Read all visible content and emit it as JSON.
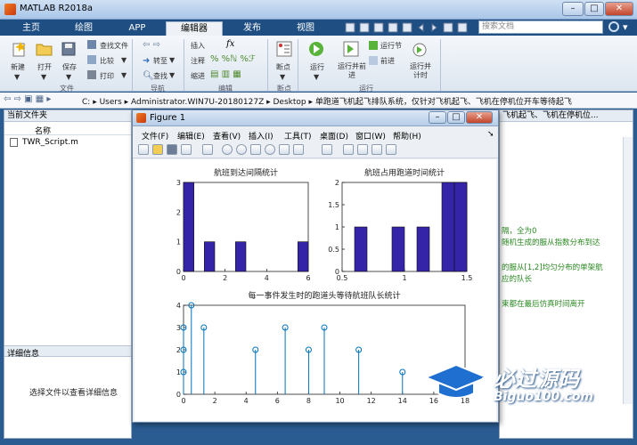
{
  "app": {
    "title": "MATLAB R2018a"
  },
  "tabs": [
    "主页",
    "绘图",
    "APP",
    "编辑器",
    "发布",
    "视图"
  ],
  "search_placeholder": "搜索文档",
  "ribbon": {
    "new": "新建",
    "open": "打开",
    "save": "保存",
    "find_files": "查找文件",
    "compare": "比较",
    "print": "打印",
    "goto": "转至",
    "find": "查找",
    "insert": "插入",
    "comment": "注释",
    "indent": "缩进",
    "breakpoints": "断点",
    "run": "运行",
    "run_advance": "运行并前进",
    "run_section": "运行节",
    "advance": "前进",
    "run_time": "运行并计时",
    "groups": {
      "file": "文件",
      "nav": "导航",
      "edit": "编辑",
      "bp": "断点",
      "run": "运行"
    }
  },
  "address": {
    "path": [
      "C:",
      "Users",
      "Administrator.WIN7U-20180127Z",
      "Desktop",
      "单跑道飞机起飞排队系统，仅针对飞机起飞、飞机在停机位开车等待起飞"
    ]
  },
  "current_folder": {
    "title": "当前文件夹",
    "column": "名称",
    "files": [
      "TWR_Script.m"
    ]
  },
  "details": {
    "title": "详细信息",
    "hint": "选择文件以查看详细信息"
  },
  "editor_bg": {
    "tab_text": "飞机起飞、飞机在停机位...",
    "lines": [
      "隔，全为0",
      "随机生成的服从指数分布到达",
      "的服从[1,2]均匀分布的单架航",
      "应的队长",
      "束都在最后仿真时间离开"
    ]
  },
  "figure": {
    "title": "Figure 1",
    "menu": [
      "文件(F)",
      "编辑(E)",
      "查看(V)",
      "插入(I)",
      "工具(T)",
      "桌面(D)",
      "窗口(W)",
      "帮助(H)"
    ]
  },
  "chart_data": [
    {
      "type": "bar",
      "title": "航班到达间隔统计",
      "x": [
        0.25,
        1.25,
        2.75,
        5.75
      ],
      "values": [
        3,
        1,
        1,
        1
      ],
      "bar_width": 0.5,
      "xlim": [
        0,
        6
      ],
      "ylim": [
        0,
        3
      ],
      "xticks": [
        0,
        2,
        4,
        6
      ],
      "yticks": [
        0,
        1,
        2,
        3
      ]
    },
    {
      "type": "bar",
      "title": "航班占用跑道时间统计",
      "x": [
        0.65,
        0.95,
        1.15,
        1.35,
        1.45
      ],
      "values": [
        1,
        1,
        1,
        2,
        2
      ],
      "bar_width": 0.1,
      "xlim": [
        0.5,
        1.5
      ],
      "ylim": [
        0,
        2
      ],
      "xticks": [
        0.5,
        1,
        1.5
      ],
      "yticks": [
        0,
        0.5,
        1,
        1.5,
        2
      ]
    },
    {
      "type": "stem",
      "title": "每一事件发生时的跑道头等待航班队长统计",
      "x": [
        0,
        0,
        0,
        0.5,
        1.3,
        4.6,
        6.5,
        8.0,
        9.0,
        11.2,
        14.0
      ],
      "values": [
        1,
        2,
        3,
        4,
        3,
        2,
        3,
        2,
        3,
        2,
        1
      ],
      "xlim": [
        0,
        18
      ],
      "ylim": [
        0,
        4
      ],
      "xticks": [
        0,
        2,
        4,
        6,
        8,
        10,
        12,
        14,
        16,
        18
      ],
      "yticks": [
        0,
        1,
        2,
        3,
        4
      ]
    }
  ],
  "watermark": {
    "brand": "必过源码",
    "url": "Biguo100.com"
  },
  "colors": {
    "bar": "#3324a8",
    "stem": "#0072bd",
    "green_text": "#2a8a22"
  }
}
